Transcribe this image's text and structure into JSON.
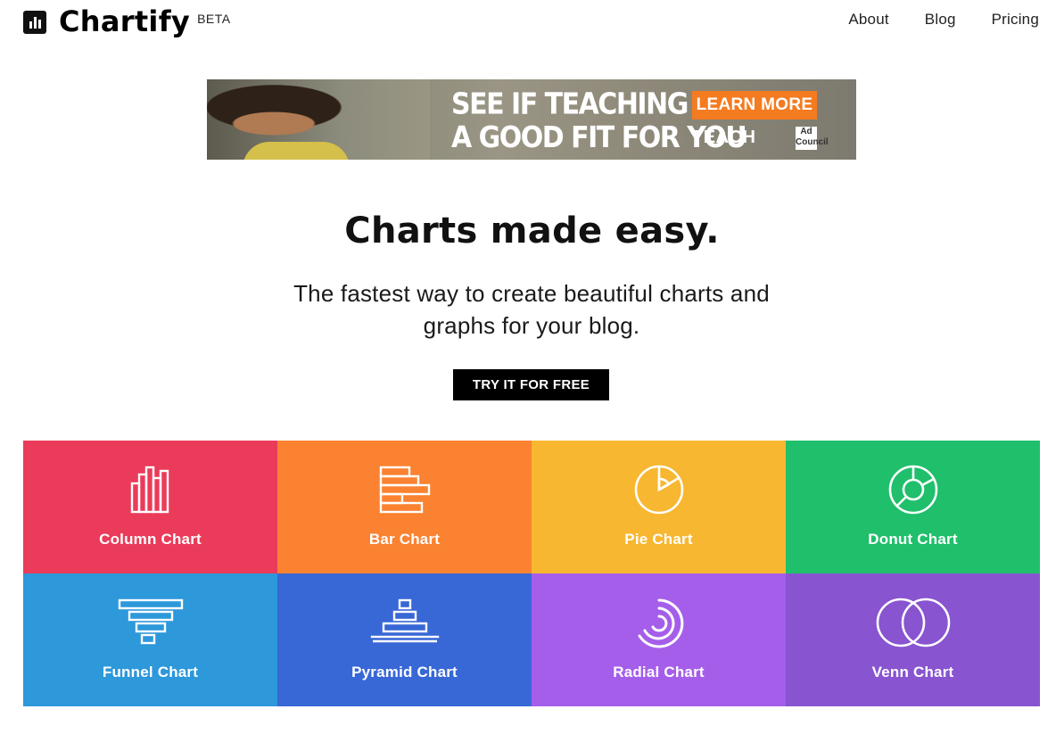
{
  "header": {
    "brand": "Chartify",
    "badge": "BETA",
    "nav": [
      {
        "label": "About"
      },
      {
        "label": "Blog"
      },
      {
        "label": "Pricing"
      }
    ]
  },
  "ad": {
    "headline_line1": "SEE IF TEACHING IS",
    "headline_line2": "A GOOD FIT FOR YOU",
    "cta": "LEARN MORE",
    "sponsor": "TEACH",
    "badge": "Ad Council"
  },
  "hero": {
    "title": "Charts made easy.",
    "subtitle": "The fastest way to create beautiful charts and graphs for your blog.",
    "cta": "TRY IT FOR FREE"
  },
  "chart_types": [
    {
      "label": "Column Chart",
      "icon": "column-chart-icon",
      "color": "#eb3b5a"
    },
    {
      "label": "Bar Chart",
      "icon": "bar-chart-icon",
      "color": "#fa8231"
    },
    {
      "label": "Pie Chart",
      "icon": "pie-chart-icon",
      "color": "#f7b731"
    },
    {
      "label": "Donut Chart",
      "icon": "donut-chart-icon",
      "color": "#20bf6b"
    },
    {
      "label": "Funnel Chart",
      "icon": "funnel-chart-icon",
      "color": "#2d98da"
    },
    {
      "label": "Pyramid Chart",
      "icon": "pyramid-chart-icon",
      "color": "#3867d6"
    },
    {
      "label": "Radial Chart",
      "icon": "radial-chart-icon",
      "color": "#a55eea"
    },
    {
      "label": "Venn Chart",
      "icon": "venn-chart-icon",
      "color": "#8854d0"
    }
  ]
}
